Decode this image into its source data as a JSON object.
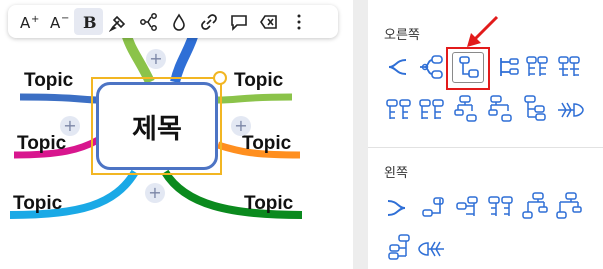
{
  "canvas": {
    "central_topic": "제목",
    "topics": [
      "Topic",
      "Topic",
      "Topic",
      "Topic",
      "Topic",
      "Topic"
    ],
    "branch_colors": {
      "top_center": "#8bc34a",
      "top_center_2": "#2f6fd6",
      "upper_left": "#3c6fc4",
      "upper_right": "#8bc34a",
      "mid_left": "#d8168e",
      "mid_right": "#ff8f1f",
      "lower_left": "#1aa9e6",
      "lower_right": "#0b8a1e"
    },
    "add_button_label": "+"
  },
  "toolbar": {
    "buttons": [
      {
        "name": "increase-font-icon",
        "label": "A+"
      },
      {
        "name": "decrease-font-icon",
        "label": "A−"
      },
      {
        "name": "bold-icon",
        "label": "B"
      },
      {
        "name": "brush-icon",
        "label": ""
      },
      {
        "name": "structure-icon",
        "label": ""
      },
      {
        "name": "fill-color-icon",
        "label": ""
      },
      {
        "name": "link-icon",
        "label": ""
      },
      {
        "name": "comment-icon",
        "label": ""
      },
      {
        "name": "delete-icon",
        "label": ""
      },
      {
        "name": "more-icon",
        "label": "⋮"
      }
    ]
  },
  "panel": {
    "section_right": "오른쪽",
    "section_left": "왼쪽",
    "accent_color": "#2f6fd6",
    "highlight_color": "#e21b1b",
    "selected_layout": "right-tree"
  }
}
